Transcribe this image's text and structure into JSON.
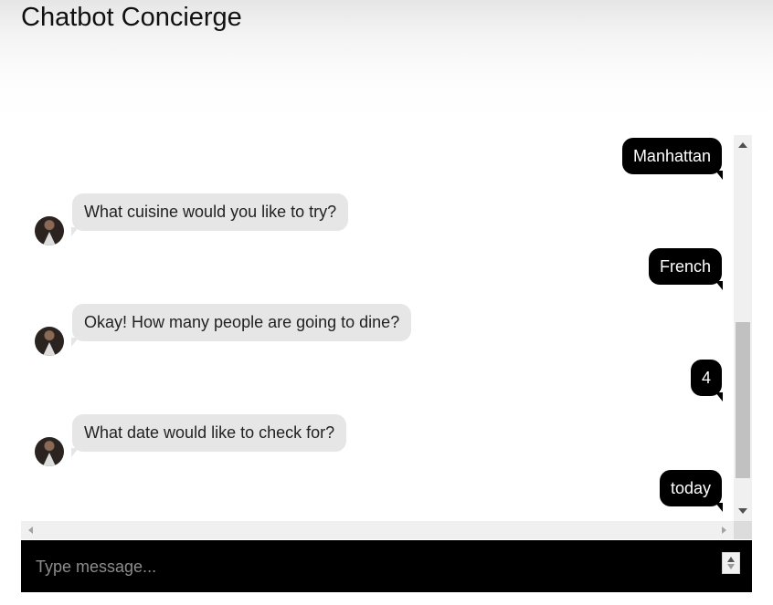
{
  "app": {
    "title": "Chatbot Concierge"
  },
  "messages": [
    {
      "sender": "user",
      "text": "Manhattan"
    },
    {
      "sender": "bot",
      "text": "What cuisine would you like to try?"
    },
    {
      "sender": "user",
      "text": "French"
    },
    {
      "sender": "bot",
      "text": "Okay! How many people are going to dine?"
    },
    {
      "sender": "user",
      "text": "4"
    },
    {
      "sender": "bot",
      "text": "What date would like to check for?"
    },
    {
      "sender": "user",
      "text": "today"
    }
  ],
  "composer": {
    "placeholder": "Type message...",
    "value": ""
  },
  "icons": {
    "avatar": "bot-avatar-icon",
    "scroll_up": "scroll-up-arrow-icon",
    "scroll_down": "scroll-down-arrow-icon",
    "scroll_left": "scroll-left-arrow-icon",
    "scroll_right": "scroll-right-arrow-icon",
    "stepper": "stepper-icon"
  },
  "colors": {
    "user_bubble": "#000000",
    "bot_bubble": "#e6e6e6",
    "input_bar": "#000000",
    "placeholder": "#8c8c8c"
  }
}
